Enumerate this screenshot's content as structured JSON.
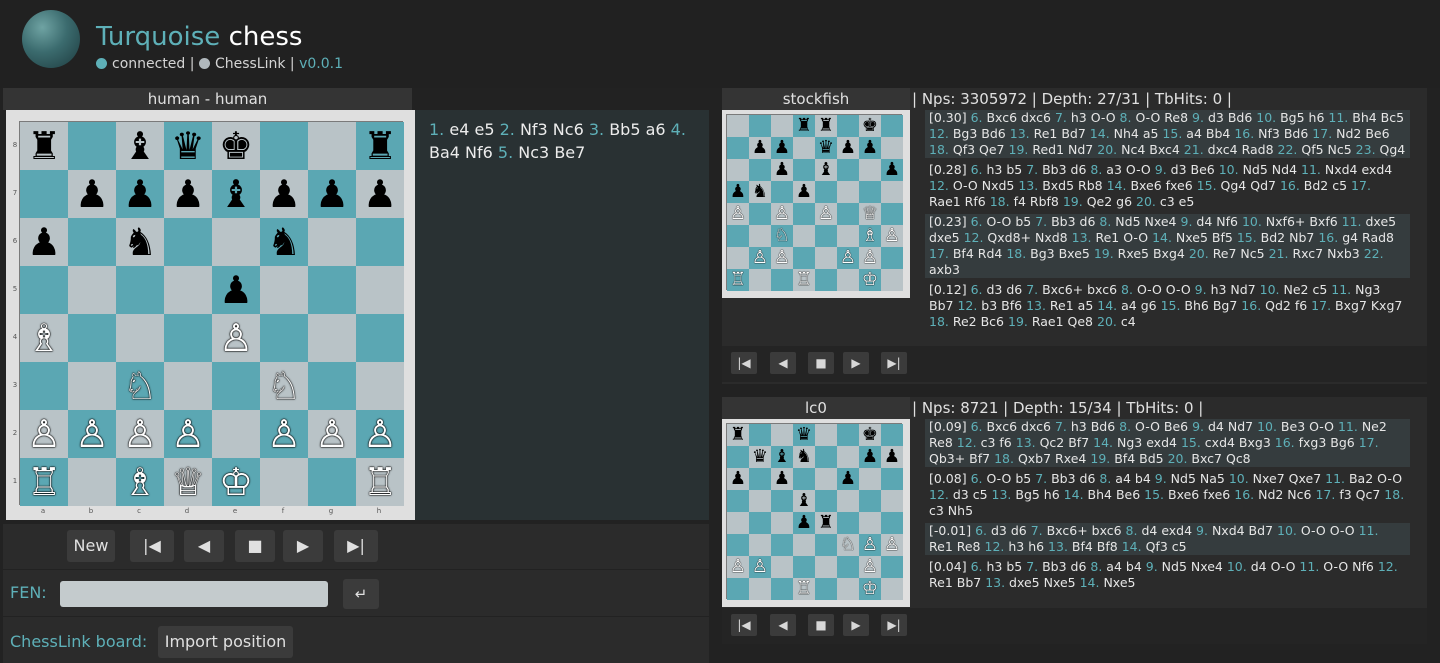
{
  "header": {
    "title_accent": "Turquoise",
    "title_rest": " chess",
    "status_connected": "connected",
    "separator": "|",
    "status_chesslink": "ChessLink",
    "version": "v0.0.1",
    "connected_color": "#5eb0b8",
    "chesslink_color": "#b0b8bc"
  },
  "game": {
    "title": "human - human",
    "moves": [
      {
        "num": "1.",
        "text": "e4 e5"
      },
      {
        "num": "2.",
        "text": "Nf3 Nc6"
      },
      {
        "num": "3.",
        "text": "Bb5 a6"
      },
      {
        "num": "4.",
        "text": "Ba4 Nf6"
      },
      {
        "num": "5.",
        "text": "Nc3 Be7"
      }
    ],
    "ranks": [
      "8",
      "7",
      "6",
      "5",
      "4",
      "3",
      "2",
      "1"
    ],
    "files": [
      "a",
      "b",
      "c",
      "d",
      "e",
      "f",
      "g",
      "h"
    ],
    "board": [
      "r.bqk..r",
      ".pppbppp",
      "p.n..n..",
      "....p...",
      "B...P...",
      "..N..N..",
      "PPPP.PPP",
      "R.BQK..R"
    ]
  },
  "controls": {
    "new": "New",
    "first": "|◀",
    "prev": "◀",
    "stop": "■",
    "next": "▶",
    "last": "▶|"
  },
  "fen": {
    "label": "FEN:",
    "value": "",
    "enter": "↵"
  },
  "chesslink": {
    "label": "ChessLink board:",
    "import": "Import position"
  },
  "engines": [
    {
      "name": "stockfish",
      "stats": "| Nps: 3305972 | Depth: 27/31 | TbHits: 0 |",
      "board": [
        "...rr.k.",
        ".pp.qpp.",
        "..p.b..p",
        "pn.p....",
        "P.P.P.Q.",
        "..N...BP",
        ".PP..PP.",
        "R..R..K."
      ],
      "pvs": [
        {
          "eval": "[0.30]",
          "moves": [
            [
              "6.",
              "Bxc6 dxc6"
            ],
            [
              "7.",
              "h3 O-O"
            ],
            [
              "8.",
              "O-O Re8"
            ],
            [
              "9.",
              "d3 Bd6"
            ],
            [
              "10.",
              "Bg5 h6"
            ],
            [
              "11.",
              "Bh4 Bc5"
            ],
            [
              "12.",
              "Bg3 Bd6"
            ],
            [
              "13.",
              "Re1 Bd7"
            ],
            [
              "14.",
              "Nh4 a5"
            ],
            [
              "15.",
              "a4 Bb4"
            ],
            [
              "16.",
              "Nf3 Bd6"
            ],
            [
              "17.",
              "Nd2 Be6"
            ],
            [
              "18.",
              "Qf3 Qe7"
            ],
            [
              "19.",
              "Red1 Nd7"
            ],
            [
              "20.",
              "Nc4 Bxc4"
            ],
            [
              "21.",
              "dxc4 Rad8"
            ],
            [
              "22.",
              "Qf5 Nc5"
            ],
            [
              "23.",
              "Qg4"
            ]
          ]
        },
        {
          "eval": "[0.28]",
          "moves": [
            [
              "6.",
              "h3 b5"
            ],
            [
              "7.",
              "Bb3 d6"
            ],
            [
              "8.",
              "a3 O-O"
            ],
            [
              "9.",
              "d3 Be6"
            ],
            [
              "10.",
              "Nd5 Nd4"
            ],
            [
              "11.",
              "Nxd4 exd4"
            ],
            [
              "12.",
              "O-O Nxd5"
            ],
            [
              "13.",
              "Bxd5 Rb8"
            ],
            [
              "14.",
              "Bxe6 fxe6"
            ],
            [
              "15.",
              "Qg4 Qd7"
            ],
            [
              "16.",
              "Bd2 c5"
            ],
            [
              "17.",
              "Rae1 Rf6"
            ],
            [
              "18.",
              "f4 Rbf8"
            ],
            [
              "19.",
              "Qe2 g6"
            ],
            [
              "20.",
              "c3 e5"
            ]
          ]
        },
        {
          "eval": "[0.23]",
          "moves": [
            [
              "6.",
              "O-O b5"
            ],
            [
              "7.",
              "Bb3 d6"
            ],
            [
              "8.",
              "Nd5 Nxe4"
            ],
            [
              "9.",
              "d4 Nf6"
            ],
            [
              "10.",
              "Nxf6+ Bxf6"
            ],
            [
              "11.",
              "dxe5 dxe5"
            ],
            [
              "12.",
              "Qxd8+ Nxd8"
            ],
            [
              "13.",
              "Re1 O-O"
            ],
            [
              "14.",
              "Nxe5 Bf5"
            ],
            [
              "15.",
              "Bd2 Nb7"
            ],
            [
              "16.",
              "g4 Rad8"
            ],
            [
              "17.",
              "Bf4 Rd4"
            ],
            [
              "18.",
              "Bg3 Bxe5"
            ],
            [
              "19.",
              "Rxe5 Bxg4"
            ],
            [
              "20.",
              "Re7 Nc5"
            ],
            [
              "21.",
              "Rxc7 Nxb3"
            ],
            [
              "22.",
              "axb3"
            ]
          ]
        },
        {
          "eval": "[0.12]",
          "moves": [
            [
              "6.",
              "d3 d6"
            ],
            [
              "7.",
              "Bxc6+ bxc6"
            ],
            [
              "8.",
              "O-O O-O"
            ],
            [
              "9.",
              "h3 Nd7"
            ],
            [
              "10.",
              "Ne2 c5"
            ],
            [
              "11.",
              "Ng3 Bb7"
            ],
            [
              "12.",
              "b3 Bf6"
            ],
            [
              "13.",
              "Re1 a5"
            ],
            [
              "14.",
              "a4 g6"
            ],
            [
              "15.",
              "Bh6 Bg7"
            ],
            [
              "16.",
              "Qd2 f6"
            ],
            [
              "17.",
              "Bxg7 Kxg7"
            ],
            [
              "18.",
              "Re2 Bc6"
            ],
            [
              "19.",
              "Rae1 Qe8"
            ],
            [
              "20.",
              "c4"
            ]
          ]
        }
      ]
    },
    {
      "name": "lc0",
      "stats": "| Nps: 8721 | Depth: 15/34 | TbHits: 0 |",
      "board": [
        "r..q..k.",
        ".qbn..pp",
        "p.p..p..",
        "...b....",
        "...pr...",
        ".....NPP",
        "PP....P.",
        "...R..K."
      ],
      "pvs": [
        {
          "eval": "[0.09]",
          "moves": [
            [
              "6.",
              "Bxc6 dxc6"
            ],
            [
              "7.",
              "h3 Bd6"
            ],
            [
              "8.",
              "O-O Be6"
            ],
            [
              "9.",
              "d4 Nd7"
            ],
            [
              "10.",
              "Be3 O-O"
            ],
            [
              "11.",
              "Ne2 Re8"
            ],
            [
              "12.",
              "c3 f6"
            ],
            [
              "13.",
              "Qc2 Bf7"
            ],
            [
              "14.",
              "Ng3 exd4"
            ],
            [
              "15.",
              "cxd4 Bxg3"
            ],
            [
              "16.",
              "fxg3 Bg6"
            ],
            [
              "17.",
              "Qb3+ Bf7"
            ],
            [
              "18.",
              "Qxb7 Rxe4"
            ],
            [
              "19.",
              "Bf4 Bd5"
            ],
            [
              "20.",
              "Bxc7 Qc8"
            ]
          ]
        },
        {
          "eval": "[0.08]",
          "moves": [
            [
              "6.",
              "O-O b5"
            ],
            [
              "7.",
              "Bb3 d6"
            ],
            [
              "8.",
              "a4 b4"
            ],
            [
              "9.",
              "Nd5 Na5"
            ],
            [
              "10.",
              "Nxe7 Qxe7"
            ],
            [
              "11.",
              "Ba2 O-O"
            ],
            [
              "12.",
              "d3 c5"
            ],
            [
              "13.",
              "Bg5 h6"
            ],
            [
              "14.",
              "Bh4 Be6"
            ],
            [
              "15.",
              "Bxe6 fxe6"
            ],
            [
              "16.",
              "Nd2 Nc6"
            ],
            [
              "17.",
              "f3 Qc7"
            ],
            [
              "18.",
              "c3 Nh5"
            ]
          ]
        },
        {
          "eval": "[-0.01]",
          "moves": [
            [
              "6.",
              "d3 d6"
            ],
            [
              "7.",
              "Bxc6+ bxc6"
            ],
            [
              "8.",
              "d4 exd4"
            ],
            [
              "9.",
              "Nxd4 Bd7"
            ],
            [
              "10.",
              "O-O O-O"
            ],
            [
              "11.",
              "Re1 Re8"
            ],
            [
              "12.",
              "h3 h6"
            ],
            [
              "13.",
              "Bf4 Bf8"
            ],
            [
              "14.",
              "Qf3 c5"
            ]
          ]
        },
        {
          "eval": "[0.04]",
          "moves": [
            [
              "6.",
              "h3 b5"
            ],
            [
              "7.",
              "Bb3 d6"
            ],
            [
              "8.",
              "a4 b4"
            ],
            [
              "9.",
              "Nd5 Nxe4"
            ],
            [
              "10.",
              "d4 O-O"
            ],
            [
              "11.",
              "O-O Nf6"
            ],
            [
              "12.",
              "Re1 Bb7"
            ],
            [
              "13.",
              "dxe5 Nxe5"
            ],
            [
              "14.",
              "Nxe5"
            ]
          ]
        }
      ]
    }
  ],
  "pieces": {
    "K": "♔",
    "Q": "♕",
    "R": "♖",
    "B": "♗",
    "N": "♘",
    "P": "♙",
    "k": "♚",
    "q": "♛",
    "r": "♜",
    "b": "♝",
    "n": "♞",
    "p": "♟"
  }
}
